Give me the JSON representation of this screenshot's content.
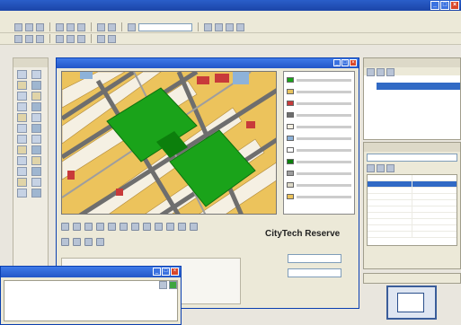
{
  "form": {
    "service_title": "CityTech Reserve"
  },
  "colors": {
    "titlebar": "#2356c7",
    "park": "#1aa31a",
    "parcels": "#e8c45f",
    "roads": "#6e6e6e",
    "selection": "#316ac5"
  },
  "icons": [
    "minimize-icon",
    "maximize-icon",
    "close-icon",
    "toolbar-icon",
    "tool-icon",
    "map-tool-icon"
  ]
}
